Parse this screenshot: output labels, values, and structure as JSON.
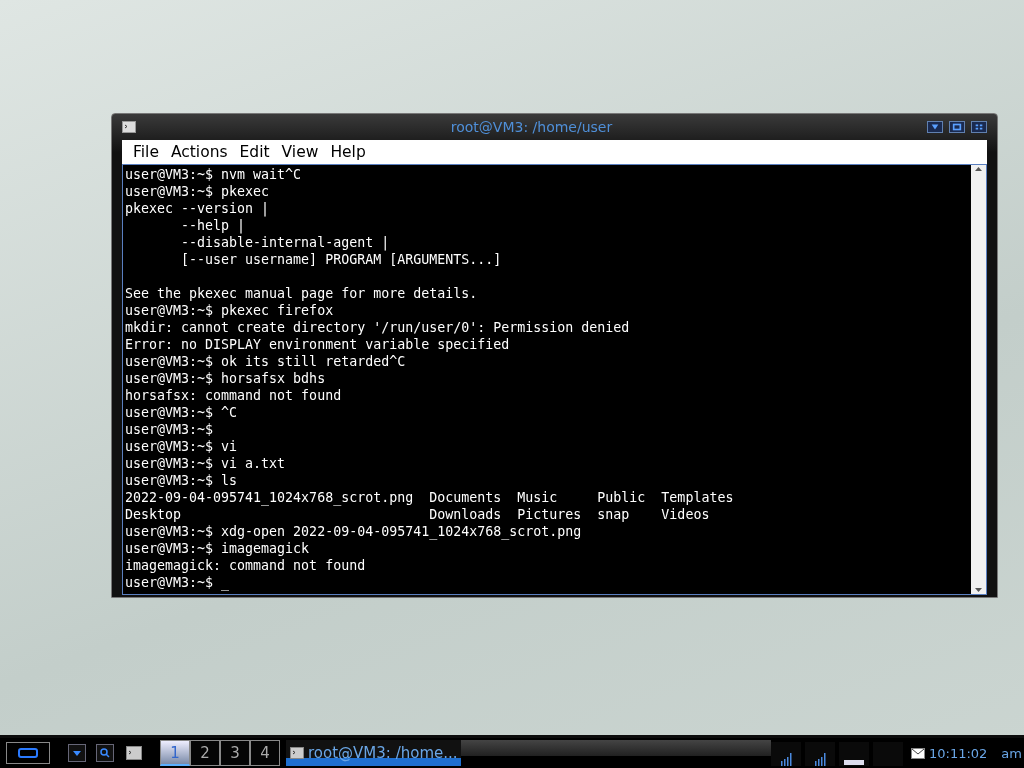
{
  "window": {
    "title": "root@VM3: /home/user"
  },
  "menu": [
    "File",
    "Actions",
    "Edit",
    "View",
    "Help"
  ],
  "terminal": {
    "blocks": [
      [
        "user@VM3:~$ nvm wait^C",
        "user@VM3:~$ pkexec",
        "pkexec --version |",
        "       --help |",
        "       --disable-internal-agent |",
        "       [--user username] PROGRAM [ARGUMENTS...]"
      ],
      [
        "See the pkexec manual page for more details.",
        "user@VM3:~$ pkexec firefox",
        "mkdir: cannot create directory '/run/user/0': Permission denied",
        "Error: no DISPLAY environment variable specified",
        "user@VM3:~$ ok its still retarded^C",
        "user@VM3:~$ horsafsx bdhs",
        "horsafsx: command not found",
        "user@VM3:~$ ^C",
        "user@VM3:~$",
        "user@VM3:~$ vi",
        "user@VM3:~$ vi a.txt",
        "user@VM3:~$ ls",
        "2022-09-04-095741_1024x768_scrot.png  Documents  Music     Public  Templates",
        "Desktop                               Downloads  Pictures  snap    Videos",
        "user@VM3:~$ xdg-open 2022-09-04-095741_1024x768_scrot.png",
        "user@VM3:~$ imagemagick",
        "imagemagick: command not found",
        "user@VM3:~$ _"
      ]
    ]
  },
  "taskbar": {
    "workspaces": [
      {
        "label": "1",
        "selected": true
      },
      {
        "label": "2",
        "selected": false
      },
      {
        "label": "3",
        "selected": false
      },
      {
        "label": "4",
        "selected": false
      }
    ],
    "task": {
      "label": "root@VM3: /home..."
    },
    "clock": {
      "time": "10:11:02",
      "period": "am"
    }
  }
}
